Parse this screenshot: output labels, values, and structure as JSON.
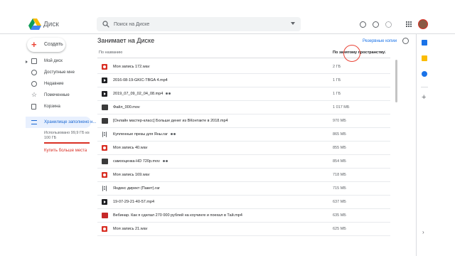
{
  "header": {
    "app_title": "Диск",
    "search_placeholder": "Поиск на Диске"
  },
  "nav": {
    "create_label": "Создать",
    "items": [
      {
        "label": "Мой диск",
        "icon": "drive-icon"
      },
      {
        "label": "Доступные мне",
        "icon": "people-icon"
      },
      {
        "label": "Недавние",
        "icon": "clock-icon"
      },
      {
        "label": "Помеченные",
        "icon": "star-icon"
      },
      {
        "label": "Корзина",
        "icon": "trash-icon"
      }
    ],
    "storage_label": "Хранилище заполнено н...",
    "storage_usage": "Использовано 99,9 ГБ из 100 ГБ",
    "storage_fraction": 0.999,
    "buy_more": "Купить больше места"
  },
  "main": {
    "title": "Занимает на Диске",
    "backup_link": "Резервные копии",
    "col_name": "По названию",
    "col_size": "По занятому пространству",
    "files": [
      {
        "name": "Моя запись 172.wav",
        "size": "2 ГБ",
        "type": "audio",
        "shared": false
      },
      {
        "name": "2016-08-19-GKIC-TBGA 4.mp4",
        "size": "1 ГБ",
        "type": "video",
        "shared": false
      },
      {
        "name": "2019_07_09_02_04_08.mp4",
        "size": "1 ГБ",
        "type": "video",
        "shared": true
      },
      {
        "name": "Файл_000.mov",
        "size": "1 017 МБ",
        "type": "thumb",
        "shared": false
      },
      {
        "name": "[Онлайн мастер-класс] Больше денег из ВКонтакте в 2018.mp4",
        "size": "970 МБ",
        "type": "thumb",
        "shared": false
      },
      {
        "name": "Купленные презы для Яны.rar",
        "size": "865 МБ",
        "type": "archive",
        "shared": true
      },
      {
        "name": "Моя запись 40.wav",
        "size": "855 МБ",
        "type": "audio",
        "shared": false
      },
      {
        "name": "самооценка-HD 720p.mov",
        "size": "854 МБ",
        "type": "thumb",
        "shared": true
      },
      {
        "name": "Моя запись 169.wav",
        "size": "718 МБ",
        "type": "audio",
        "shared": false
      },
      {
        "name": "Яндекс директ (Пакет).rar",
        "size": "715 МБ",
        "type": "archive",
        "shared": false
      },
      {
        "name": "19-07-29-21-40-57.mp4",
        "size": "637 МБ",
        "type": "video",
        "shared": false
      },
      {
        "name": "Вебинар. Как я сделал 270 000 рублей на коучинге и поехал в Тай.mp4",
        "size": "635 МБ",
        "type": "thumb-red",
        "shared": false
      },
      {
        "name": "Моя запись 21.wav",
        "size": "625 МБ",
        "type": "audio",
        "shared": false
      }
    ]
  },
  "colors": {
    "accent": "#1a73e8",
    "warning": "#d93025",
    "active_bg": "#e8f0fe"
  }
}
